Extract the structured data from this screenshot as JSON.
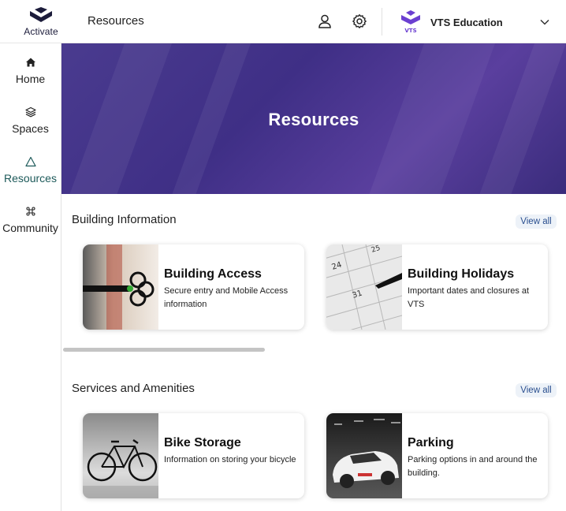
{
  "brand": {
    "logo_text": "Activate"
  },
  "header": {
    "title": "Resources",
    "org_name": "VTS Education",
    "org_logo_text": "VTS"
  },
  "sidebar": {
    "items": [
      {
        "label": "Home",
        "icon": "home-icon"
      },
      {
        "label": "Spaces",
        "icon": "layers-icon"
      },
      {
        "label": "Resources",
        "icon": "triangle-icon",
        "active": true
      },
      {
        "label": "Community",
        "icon": "command-icon"
      }
    ]
  },
  "hero": {
    "title": "Resources"
  },
  "sections": [
    {
      "title": "Building Information",
      "view_all": "View all",
      "cards": [
        {
          "title": "Building Access",
          "description": "Secure entry and Mobile Access information",
          "image": "keys-photo"
        },
        {
          "title": "Building Holidays",
          "description": "Important dates and closures at VTS",
          "image": "calendar-photo"
        }
      ]
    },
    {
      "title": "Services and Amenities",
      "view_all": "View all",
      "cards": [
        {
          "title": "Bike Storage",
          "description": "Information on storing your bicycle",
          "image": "bicycle-photo"
        },
        {
          "title": "Parking",
          "description": "Parking options in and around the building.",
          "image": "car-photo"
        }
      ]
    }
  ],
  "colors": {
    "accent": "#1d5a5a",
    "hero": "#4a3b8f",
    "link": "#2a4f8f",
    "brand": "#1b1b3a"
  }
}
